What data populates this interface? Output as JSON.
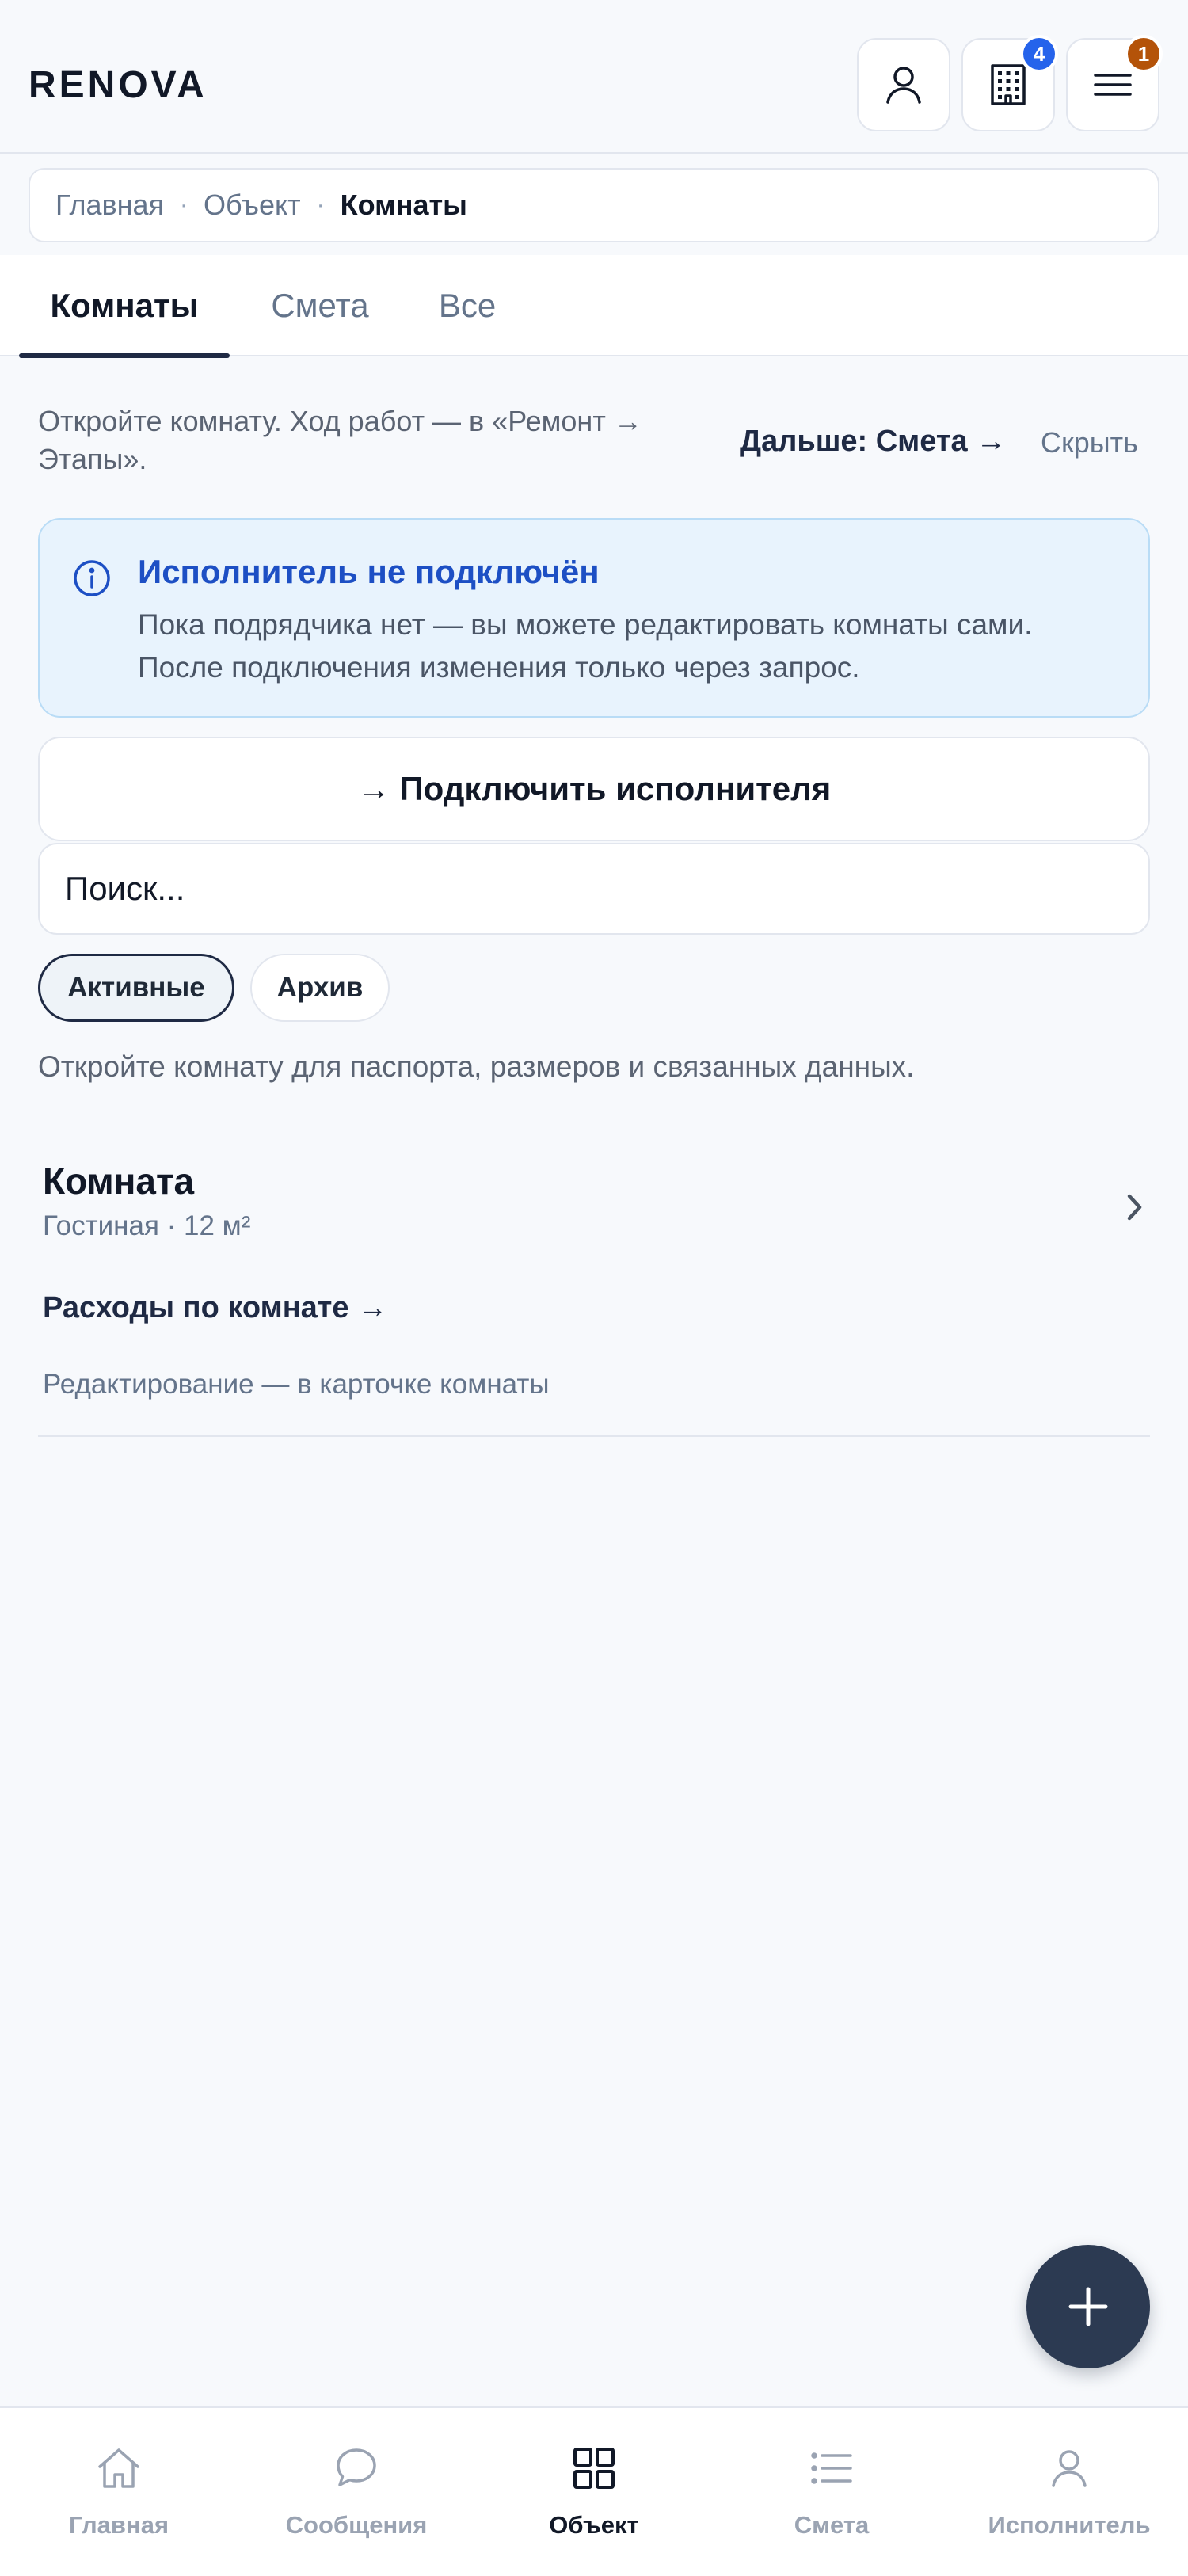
{
  "header": {
    "logo": "RENOVA",
    "objects_badge": "4",
    "menu_badge": "1",
    "objects_badge_color": "#2563eb",
    "menu_badge_color": "#b45309"
  },
  "breadcrumb": {
    "items": [
      "Главная",
      "Объект"
    ],
    "current": "Комнаты",
    "separator": "·"
  },
  "tabs": [
    {
      "label": "Комнаты",
      "active": true
    },
    {
      "label": "Смета",
      "active": false
    },
    {
      "label": "Все",
      "active": false
    }
  ],
  "hint": {
    "text": "Откройте комнату. Ход работ — в «Ремонт → Этапы».",
    "next": "Дальше: Смета →",
    "hide": "Скрыть"
  },
  "info": {
    "icon": "info-icon",
    "title": "Исполнитель не подключён",
    "text": "Пока подрядчика нет — вы можете редактировать комнаты сами. После подключения изменения только через запрос."
  },
  "connect_button": "→ Подключить исполнителя",
  "search": {
    "placeholder": "Поиск..."
  },
  "filters": [
    {
      "label": "Активные",
      "active": true
    },
    {
      "label": "Архив",
      "active": false
    }
  ],
  "list_hint": "Откройте комнату для паспорта, размеров и связанных данных.",
  "room": {
    "title": "Комната",
    "subtitle": "Гостиная · 12 м²",
    "expenses_link": "Расходы по комнате →",
    "edit_hint": "Редактирование — в карточке комнаты"
  },
  "fab": {
    "icon": "plus-icon"
  },
  "bottom_nav": [
    {
      "label": "Главная",
      "icon": "home-icon",
      "active": false
    },
    {
      "label": "Сообщения",
      "icon": "chat-icon",
      "active": false
    },
    {
      "label": "Объект",
      "icon": "grid-icon",
      "active": true
    },
    {
      "label": "Смета",
      "icon": "list-icon",
      "active": false
    },
    {
      "label": "Исполнитель",
      "icon": "user-icon",
      "active": false
    }
  ]
}
